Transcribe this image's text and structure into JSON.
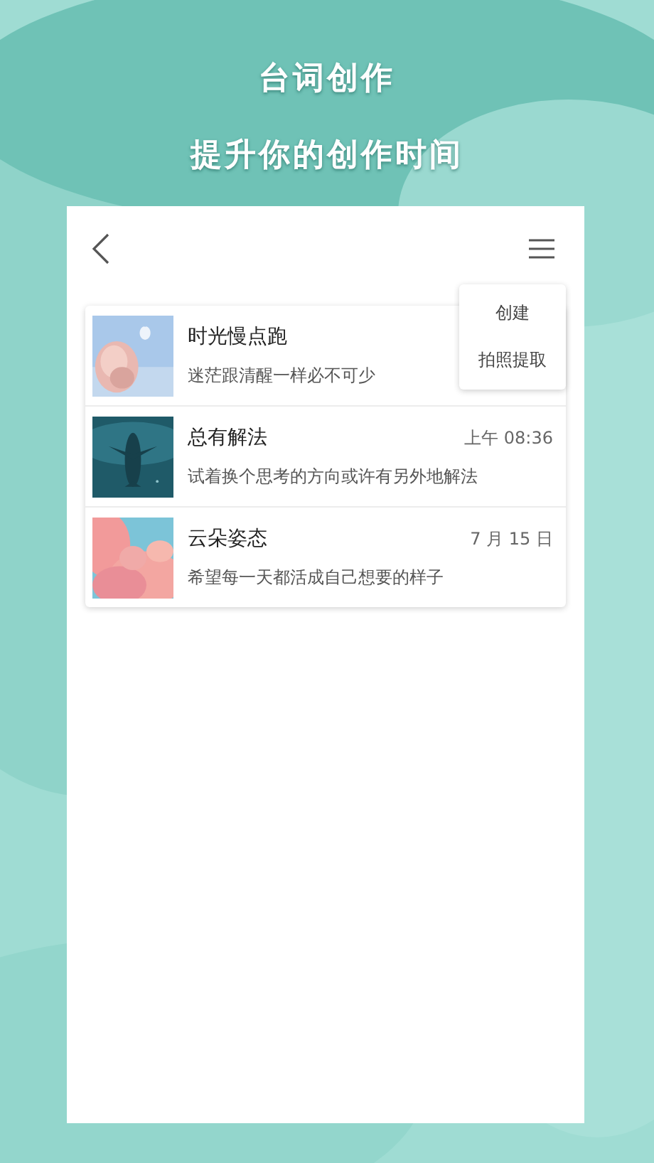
{
  "headline": [
    "台词创作",
    "提升你的创作时间"
  ],
  "menu": [
    {
      "label": "创建"
    },
    {
      "label": "拍照提取"
    }
  ],
  "notes": [
    {
      "title": "时光慢点跑",
      "preview": "迷茫跟清醒一样必不可少"
    },
    {
      "title": "总有解法",
      "time": "上午 08:36",
      "preview": "试着换个思考的方向或许有另外地解法"
    },
    {
      "title": "云朵姿态",
      "time": "7 月 15 日",
      "preview": "希望每一天都活成自己想要的样子"
    }
  ]
}
